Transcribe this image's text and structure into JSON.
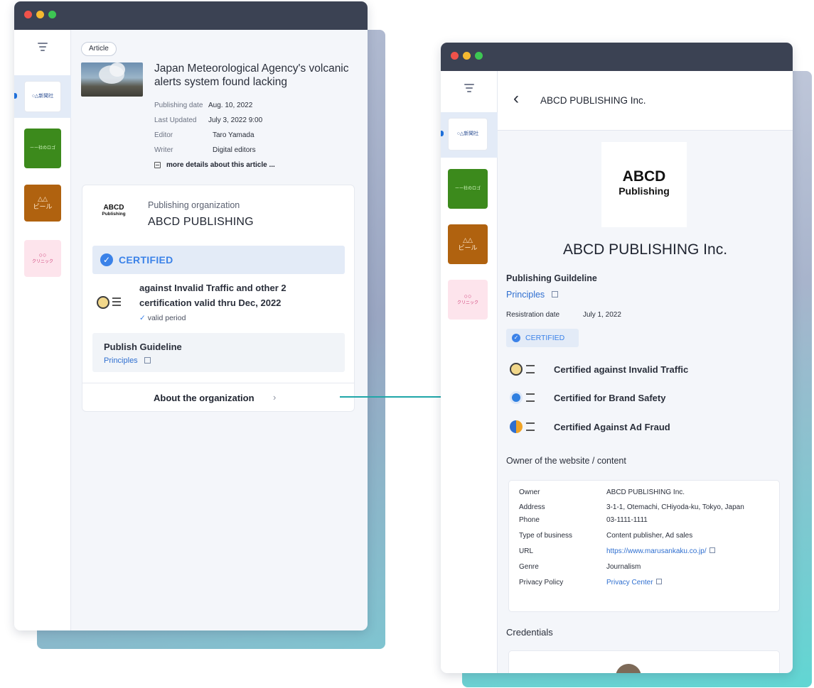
{
  "article": {
    "tag": "Article",
    "title": "Japan Meteorological Agency's volcanic alerts system found lacking",
    "meta": [
      {
        "label": "Publishing date",
        "value": "Aug. 10, 2022"
      },
      {
        "label": "Last Updated",
        "value": "July 3, 2022 9:00"
      },
      {
        "label": "Editor",
        "value": "Taro Yamada"
      },
      {
        "label": "Writer",
        "value": "Digital editors"
      }
    ],
    "more_details": "more details about this article ..."
  },
  "org_card": {
    "logo_line1": "ABCD",
    "logo_line2": "Publishing",
    "caption": "Publishing organization",
    "name": "ABCD PUBLISHING",
    "certified": "CERTIFIED",
    "cert_line1": "against Invalid Traffic and other 2",
    "cert_line2": "certification valid thru Dec, 2022",
    "valid_period": "valid period",
    "guideline_title": "Publish Guideline",
    "guideline_link": "Principles",
    "about": "About the organization"
  },
  "detail": {
    "header": "ABCD PUBLISHING Inc.",
    "logo_line1": "ABCD",
    "logo_line2": "Publishing",
    "org_name": "ABCD PUBLISHING Inc.",
    "guideline_title": "Publishing Guildeline",
    "guideline_link": "Principles",
    "reg_label": "Resistration date",
    "reg_value": "July 1, 2022",
    "certified": "CERTIFIED",
    "certs": [
      "Certified against Invalid Traffic",
      "Certified for Brand Safety",
      "Certified Against Ad Fraud"
    ],
    "owner_heading": "Owner of the website / content",
    "owner": [
      {
        "label": "Owner",
        "value": "ABCD PUBLISHING Inc."
      },
      {
        "label": "Address",
        "value": "3-1-1, Otemachi, CHiyoda-ku, Tokyo, Japan"
      },
      {
        "label": "Phone",
        "value": "03-1111-1111"
      },
      {
        "label": "Type of business",
        "value": "Content publisher, Ad sales"
      },
      {
        "label": "URL",
        "value": "https://www.marusankaku.co.jp/"
      },
      {
        "label": "Genre",
        "value": "Journalism"
      },
      {
        "label": "Privacy Policy",
        "value": "Privacy Center"
      }
    ],
    "credentials": "Credentials"
  },
  "sidebar_tiles": {
    "t1": "○△新聞社",
    "t2": "ーー社のロゴ",
    "t3_line1": "△△",
    "t3_line2": "ビール",
    "t4_line1": "○○",
    "t4_line2": "クリニック"
  },
  "colors": {
    "titlebar": "#3b4253",
    "dot_red": "#f0524a",
    "dot_yellow": "#f5b930",
    "dot_green": "#3dc653",
    "accent": "#2f6fd0",
    "arrow": "#1fa6a8",
    "tile_green": "#3c8a1c",
    "tile_brown": "#b0620f",
    "tile_pink": "#fde4ec"
  },
  "icons": [
    "menu-icon",
    "back-chevron-icon",
    "check-badge-icon",
    "external-link-icon",
    "chevron-right-icon",
    "certification-seal-icon",
    "document-icon"
  ]
}
